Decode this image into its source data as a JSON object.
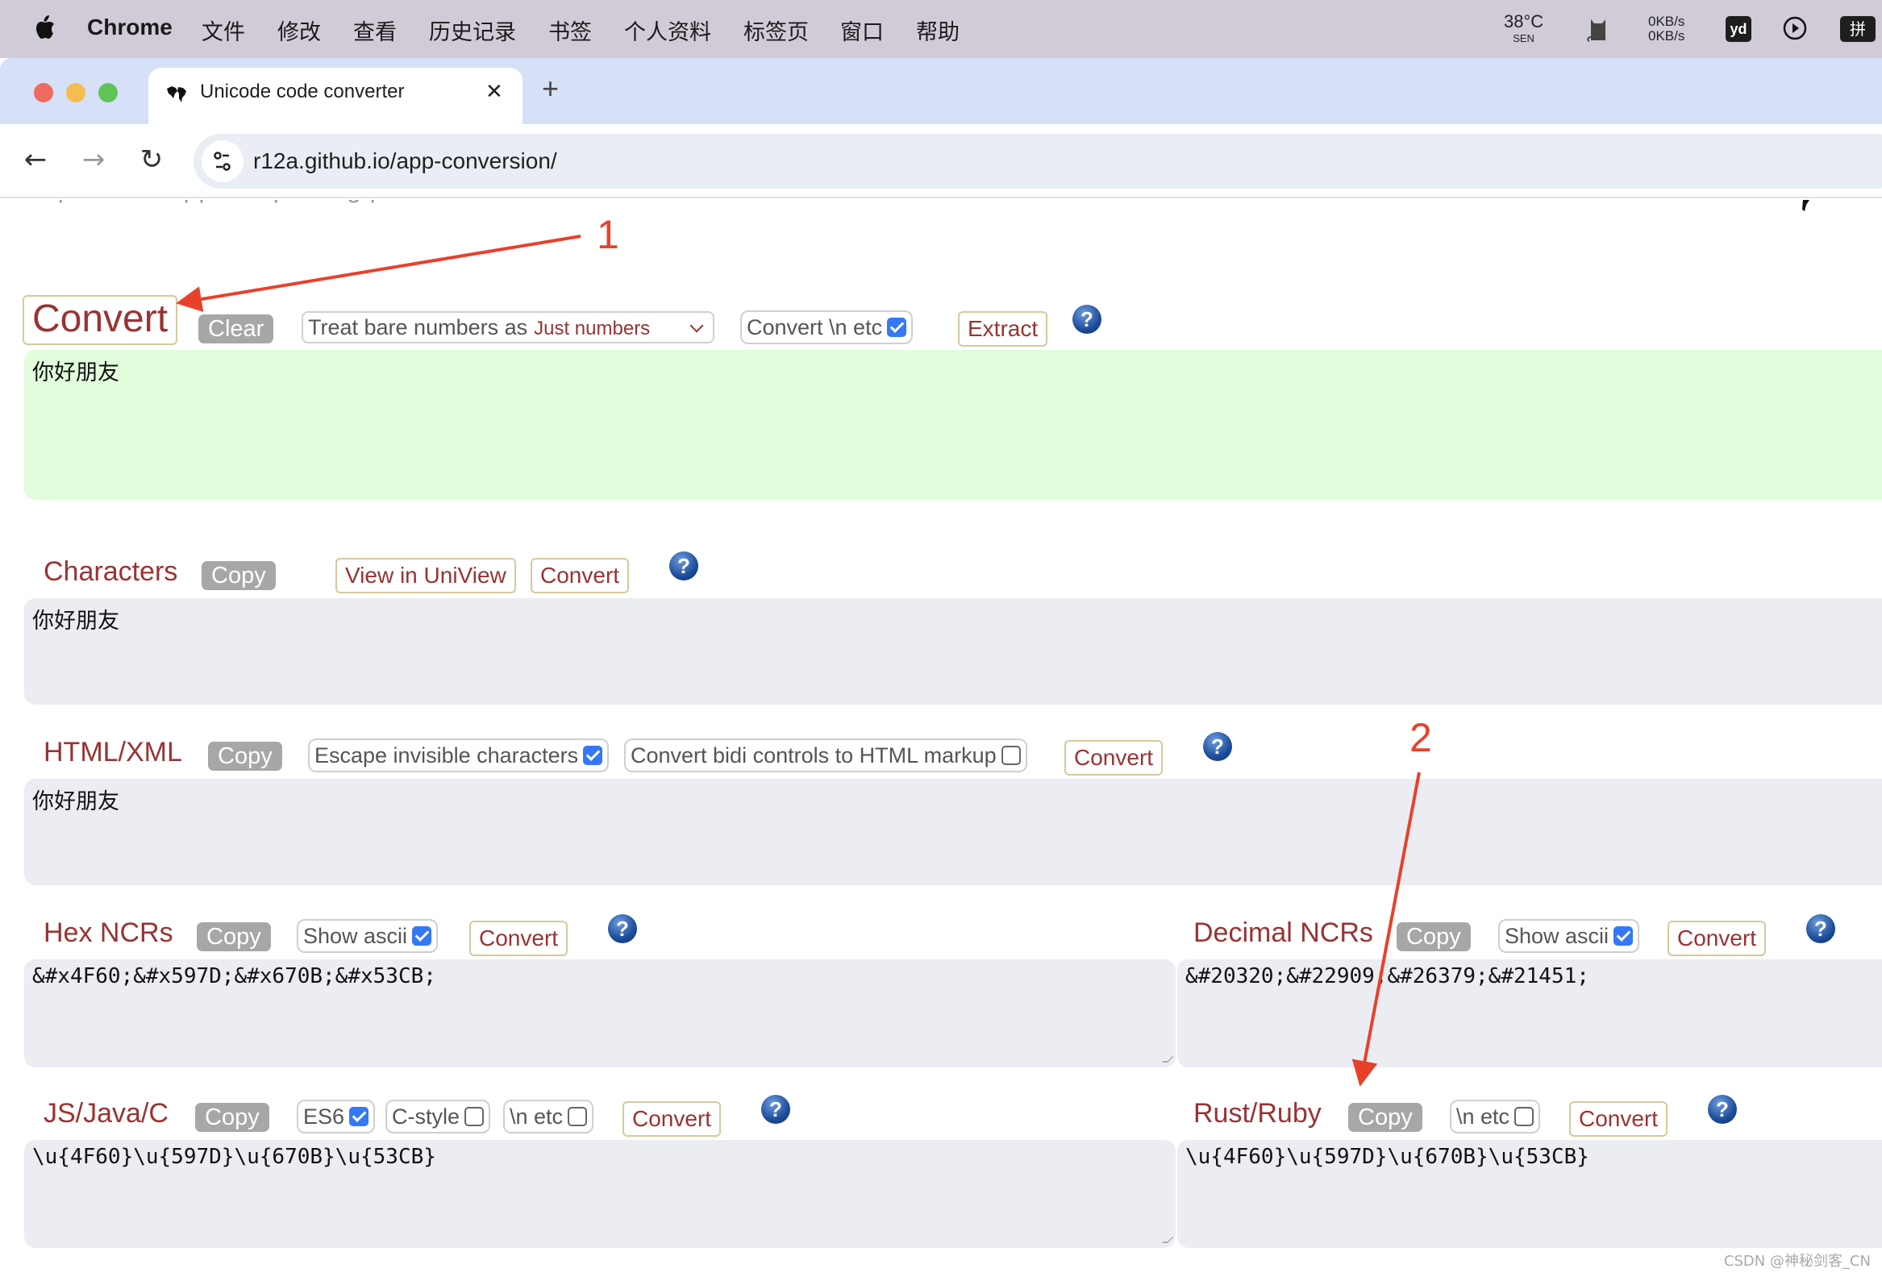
{
  "menubar": {
    "app_name": "Chrome",
    "items": [
      "文件",
      "修改",
      "查看",
      "历史记录",
      "书签",
      "个人资料",
      "标签页",
      "窗口",
      "帮助"
    ],
    "tray": {
      "temperature": "38°C",
      "temperature_sub": "SEN",
      "net_up": "0KB/s",
      "net_down": "0KB/s",
      "youdao": "yd",
      "input_method": "拼"
    }
  },
  "browser": {
    "tab_title": "Unicode code converter",
    "url": "r12a.github.io/app-conversion/"
  },
  "page": {
    "top_nav": "scripts  docs  apps  maps  blog  photos",
    "main": {
      "convert_label": "Convert",
      "clear_label": "Clear",
      "bare_numbers_label": "Treat bare numbers as",
      "bare_numbers_value": "Just numbers",
      "convert_n_label": "Convert \\n etc",
      "convert_n_checked": true,
      "extract_label": "Extract",
      "input_text": "你好朋友"
    },
    "characters": {
      "label": "Characters",
      "copy_label": "Copy",
      "uniview_label": "View in UniView",
      "convert_label": "Convert",
      "value": "你好朋友"
    },
    "html_xml": {
      "label": "HTML/XML",
      "copy_label": "Copy",
      "escape_label": "Escape invisible characters",
      "escape_checked": true,
      "bidi_label": "Convert bidi controls to HTML markup",
      "bidi_checked": false,
      "convert_label": "Convert",
      "value": "你好朋友"
    },
    "hex_ncrs": {
      "label": "Hex NCRs",
      "copy_label": "Copy",
      "show_ascii_label": "Show ascii",
      "show_ascii_checked": true,
      "convert_label": "Convert",
      "value": "&#x4F60;&#x597D;&#x670B;&#x53CB;"
    },
    "decimal_ncrs": {
      "label": "Decimal NCRs",
      "copy_label": "Copy",
      "show_ascii_label": "Show ascii",
      "show_ascii_checked": true,
      "convert_label": "Convert",
      "value": "&#20320;&#22909;&#26379;&#21451;"
    },
    "js_java_c": {
      "label": "JS/Java/C",
      "copy_label": "Copy",
      "es6_label": "ES6",
      "es6_checked": true,
      "cstyle_label": "C-style",
      "cstyle_checked": false,
      "n_etc_label": "\\n etc",
      "n_etc_checked": false,
      "convert_label": "Convert",
      "value": "\\u{4F60}\\u{597D}\\u{670B}\\u{53CB}"
    },
    "rust_ruby": {
      "label": "Rust/Ruby",
      "copy_label": "Copy",
      "n_etc_label": "\\n etc",
      "n_etc_checked": false,
      "convert_label": "Convert",
      "value": "\\u{4F60}\\u{597D}\\u{670B}\\u{53CB}"
    },
    "help_glyph": "?"
  },
  "annotations": {
    "marker_1": "1",
    "marker_2": "2",
    "color": "#e8412a"
  },
  "watermark": "CSDN @神秘剑客_CN"
}
